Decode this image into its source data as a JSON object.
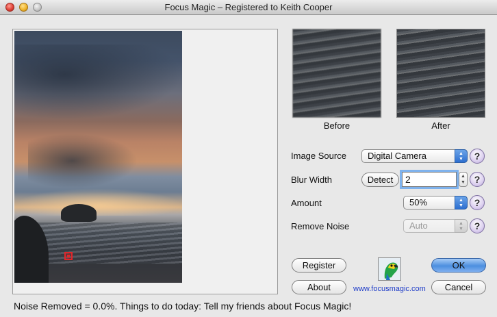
{
  "window": {
    "title": "Focus Magic – Registered to Keith Cooper"
  },
  "thumbnails": {
    "before_label": "Before",
    "after_label": "After"
  },
  "settings": {
    "image_source": {
      "label": "Image Source",
      "value": "Digital Camera"
    },
    "blur_width": {
      "label": "Blur Width",
      "detect_label": "Detect",
      "value": "2"
    },
    "amount": {
      "label": "Amount",
      "value": "50%"
    },
    "remove_noise": {
      "label": "Remove Noise",
      "value": "Auto"
    },
    "help_glyph": "?"
  },
  "buttons": {
    "register": "Register",
    "about": "About",
    "ok": "OK",
    "cancel": "Cancel"
  },
  "website": "www.focusmagic.com",
  "status_text": "Noise Removed = 0.0%. Things to do today: Tell my friends about Focus Magic!",
  "icons": [
    "close-icon",
    "minimize-icon",
    "zoom-icon",
    "help-icon",
    "parrot-logo-icon",
    "popup-arrows-icon",
    "stepper-icon"
  ],
  "colors": {
    "accent": "#4c8fe0",
    "focus_marker": "#e0262a",
    "link": "#1e3cc8"
  }
}
